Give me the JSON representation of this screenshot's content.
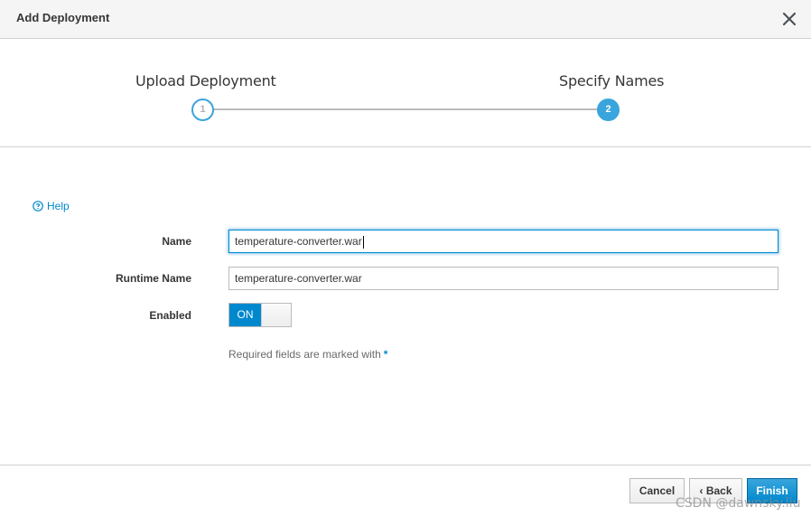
{
  "dialog": {
    "title": "Add Deployment"
  },
  "wizard": {
    "steps": [
      {
        "number": "1",
        "label": "Upload Deployment"
      },
      {
        "number": "2",
        "label": "Specify Names"
      }
    ]
  },
  "form": {
    "help_label": "Help",
    "name_label": "Name",
    "name_value": "temperature-converter.war",
    "runtime_name_label": "Runtime Name",
    "runtime_name_value": "temperature-converter.war",
    "enabled_label": "Enabled",
    "enabled_toggle_text": "ON",
    "required_note": "Required fields are marked with",
    "required_marker": "*"
  },
  "footer": {
    "cancel_label": "Cancel",
    "back_label": "‹ Back",
    "finish_label": "Finish"
  },
  "watermark": "CSDN @dawnsky.liu",
  "colors": {
    "accent": "#0088ce",
    "step_accent": "#39a5dc"
  }
}
